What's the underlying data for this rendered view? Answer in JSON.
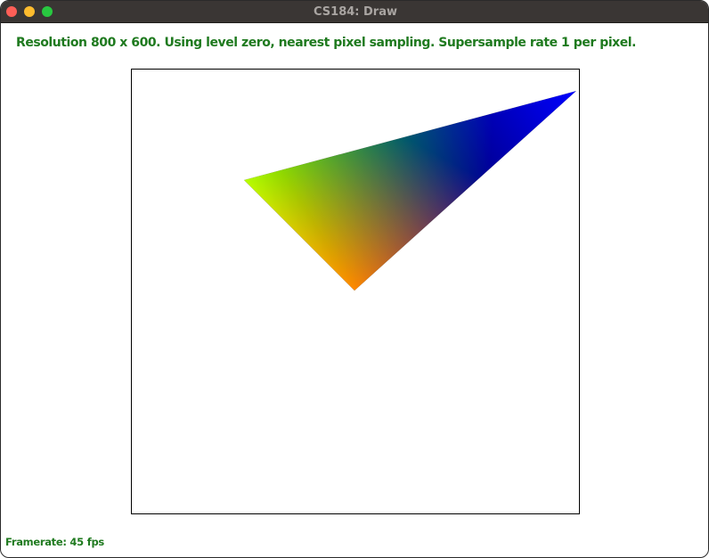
{
  "window": {
    "title": "CS184: Draw"
  },
  "status": {
    "text": "Resolution 800 x 600. Using level zero, nearest pixel sampling. Supersample rate 1 per pixel."
  },
  "triangle": {
    "vertex_colors": [
      "#00ff00",
      "#0000ff",
      "#ff0000"
    ]
  },
  "framerate": {
    "label": "Framerate: 45",
    "unit": "fps"
  },
  "colors": {
    "status_text": "#1f7a1f",
    "titlebar": "#3a3634"
  }
}
